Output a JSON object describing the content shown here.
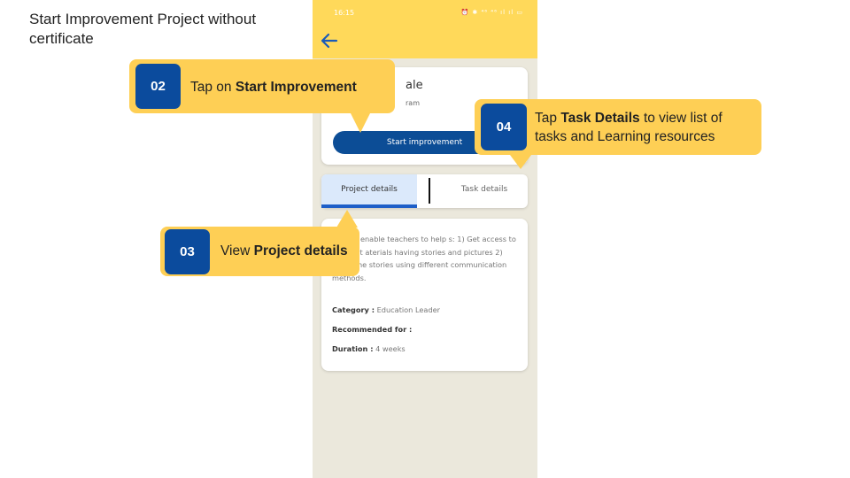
{
  "slide": {
    "title": "Start Improvement Project without certificate"
  },
  "phone": {
    "status": {
      "time": "16:15",
      "icons": "⏰ ✱ ⁴⁶ ⁴⁶ ıl ıl ▭"
    },
    "project_card": {
      "title_fragment": "ale",
      "subtitle_fragment": "ram",
      "start_button": "Start improvement"
    },
    "tabs": [
      {
        "label": "Project details",
        "selected": true
      },
      {
        "label": "Task details",
        "selected": false
      }
    ],
    "details": {
      "description": "HM will enable teachers to help s: 1) Get access to different aterials having stories and pictures 2) Retell the stories using different communication methods.",
      "category_label": "Category :",
      "category_value": "Education Leader",
      "recommended_label": "Recommended for :",
      "duration_label": "Duration :",
      "duration_value": "4 weeks"
    }
  },
  "callouts": {
    "step02": {
      "number": "02",
      "prefix": "Tap on ",
      "bold": "Start Improvement"
    },
    "step03": {
      "number": "03",
      "prefix": "View ",
      "bold": "Project details"
    },
    "step04": {
      "number": "04",
      "prefix": "Tap ",
      "bold": "Task Details",
      "suffix": " to view list of tasks and Learning resources"
    }
  },
  "colors": {
    "appbar": "#ffd95a",
    "callout": "#fecf55",
    "badge": "#0b4b9d",
    "primary_button": "#0c4d96",
    "tab_selected_bg": "#dbe9fb",
    "tab_indicator": "#1e5fc8"
  }
}
